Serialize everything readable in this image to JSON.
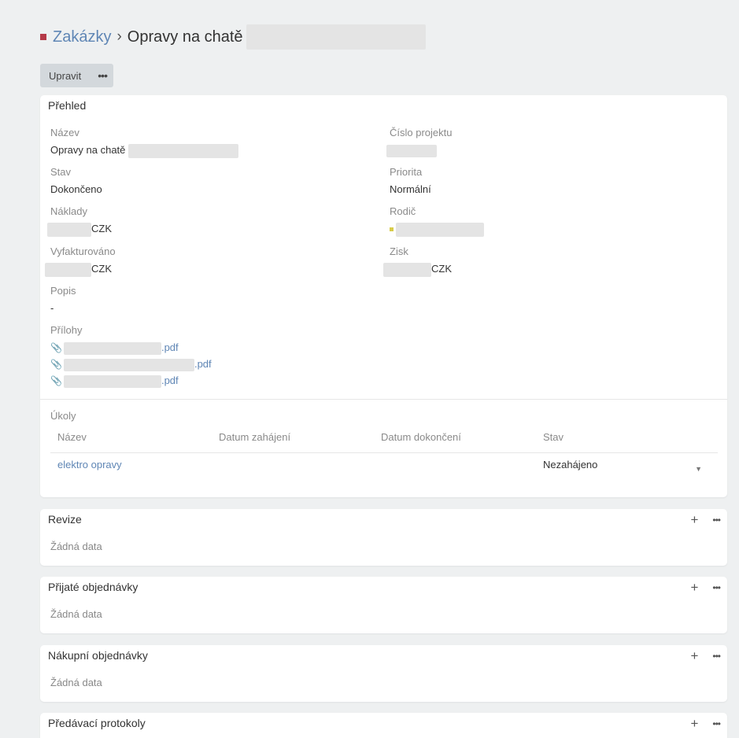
{
  "breadcrumb": {
    "parent": "Zakázky",
    "separator": "›",
    "current": "Opravy na chatě"
  },
  "toolbar": {
    "edit_label": "Upravit",
    "more_label": "•••"
  },
  "overview": {
    "title": "Přehled",
    "fields": {
      "name": {
        "label": "Název",
        "value": "Opravy na chatě"
      },
      "project_number": {
        "label": "Číslo projektu",
        "value": ""
      },
      "status": {
        "label": "Stav",
        "value": "Dokončeno"
      },
      "priority": {
        "label": "Priorita",
        "value": "Normální"
      },
      "costs": {
        "label": "Náklady",
        "currency": "CZK"
      },
      "parent": {
        "label": "Rodič"
      },
      "invoiced": {
        "label": "Vyfakturováno",
        "currency": "CZK"
      },
      "profit": {
        "label": "Zisk",
        "currency": "CZK"
      },
      "description": {
        "label": "Popis",
        "value": "-"
      }
    },
    "attachments": {
      "label": "Přílohy",
      "items": [
        {
          "suffix": ".pdf"
        },
        {
          "suffix": ".pdf"
        },
        {
          "suffix": ".pdf"
        }
      ]
    },
    "tasks": {
      "label": "Úkoly",
      "columns": [
        "Název",
        "Datum zahájení",
        "Datum dokončení",
        "Stav"
      ],
      "rows": [
        {
          "name": "elektro opravy",
          "start": "",
          "end": "",
          "status": "Nezahájeno"
        }
      ]
    }
  },
  "sections": [
    {
      "title": "Revize",
      "empty": "Žádná data",
      "add": "+",
      "more": "•••"
    },
    {
      "title": "Přijaté objednávky",
      "empty": "Žádná data",
      "add": "+",
      "more": "•••"
    },
    {
      "title": "Nákupní objednávky",
      "empty": "Žádná data",
      "add": "+",
      "more": "•••"
    },
    {
      "title": "Předávací protokoly",
      "add": "+",
      "more": "•••"
    }
  ],
  "colors": {
    "link": "#5f86b5",
    "success": "#3f9a42",
    "brand_square": "#b53a48",
    "parent_marker": "#d8cc4a"
  }
}
